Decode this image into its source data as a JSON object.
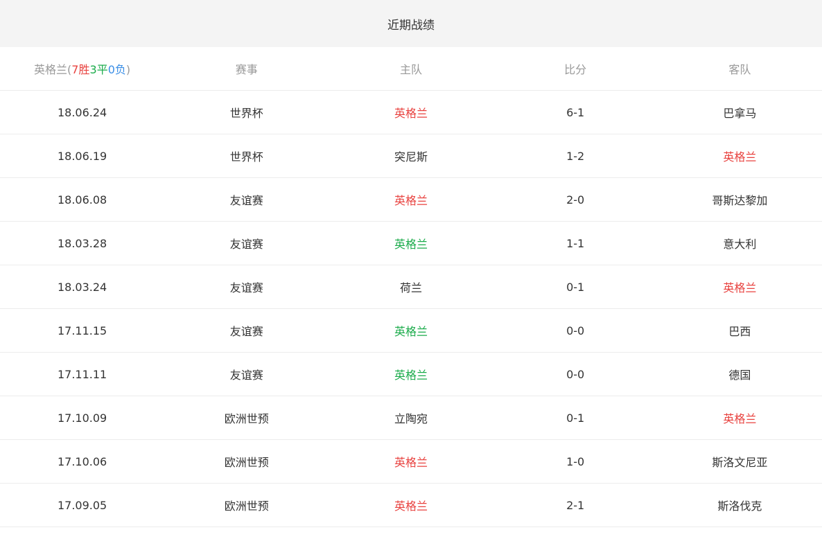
{
  "title": "近期战绩",
  "header": {
    "team": "英格兰",
    "open_paren": "(",
    "wins": "7",
    "wins_label": "胜",
    "draws": "3",
    "draws_label": "平",
    "losses": "0",
    "losses_label": "负",
    "close_paren": ")",
    "columns": [
      "赛事",
      "主队",
      "比分",
      "客队"
    ]
  },
  "colors": {
    "win": "#e8413e",
    "draw": "#1aab4a",
    "loss": "#3a8ee6",
    "neutral": "#333333"
  },
  "matches": [
    {
      "date": "18.06.24",
      "event": "世界杯",
      "home": "英格兰",
      "score": "6-1",
      "away": "巴拿马",
      "home_status": "win",
      "away_status": "neutral"
    },
    {
      "date": "18.06.19",
      "event": "世界杯",
      "home": "突尼斯",
      "score": "1-2",
      "away": "英格兰",
      "home_status": "neutral",
      "away_status": "win"
    },
    {
      "date": "18.06.08",
      "event": "友谊赛",
      "home": "英格兰",
      "score": "2-0",
      "away": "哥斯达黎加",
      "home_status": "win",
      "away_status": "neutral"
    },
    {
      "date": "18.03.28",
      "event": "友谊赛",
      "home": "英格兰",
      "score": "1-1",
      "away": "意大利",
      "home_status": "draw",
      "away_status": "neutral"
    },
    {
      "date": "18.03.24",
      "event": "友谊赛",
      "home": "荷兰",
      "score": "0-1",
      "away": "英格兰",
      "home_status": "neutral",
      "away_status": "win"
    },
    {
      "date": "17.11.15",
      "event": "友谊赛",
      "home": "英格兰",
      "score": "0-0",
      "away": "巴西",
      "home_status": "draw",
      "away_status": "neutral"
    },
    {
      "date": "17.11.11",
      "event": "友谊赛",
      "home": "英格兰",
      "score": "0-0",
      "away": "德国",
      "home_status": "draw",
      "away_status": "neutral"
    },
    {
      "date": "17.10.09",
      "event": "欧洲世预",
      "home": "立陶宛",
      "score": "0-1",
      "away": "英格兰",
      "home_status": "neutral",
      "away_status": "win"
    },
    {
      "date": "17.10.06",
      "event": "欧洲世预",
      "home": "英格兰",
      "score": "1-0",
      "away": "斯洛文尼亚",
      "home_status": "win",
      "away_status": "neutral"
    },
    {
      "date": "17.09.05",
      "event": "欧洲世预",
      "home": "英格兰",
      "score": "2-1",
      "away": "斯洛伐克",
      "home_status": "win",
      "away_status": "neutral"
    }
  ]
}
